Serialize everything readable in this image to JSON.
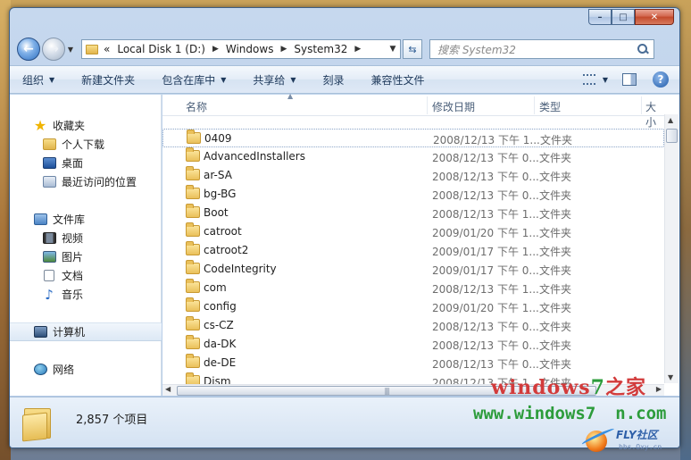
{
  "nav": {
    "breadcrumb_chevrons": "«",
    "crumbs": [
      "Local Disk 1 (D:)",
      "Windows",
      "System32"
    ],
    "search_placeholder": "搜索 System32"
  },
  "commands": [
    "组织",
    "新建文件夹",
    "包含在库中",
    "共享给",
    "刻录",
    "兼容性文件"
  ],
  "command_dropdowns": [
    true,
    false,
    true,
    true,
    false,
    false
  ],
  "sidebar": {
    "favorites": {
      "label": "收藏夹",
      "items": [
        "个人下载",
        "桌面",
        "最近访问的位置"
      ]
    },
    "libraries": {
      "label": "文件库",
      "items": [
        "视频",
        "图片",
        "文档",
        "音乐"
      ]
    },
    "computer": "计算机",
    "network": "网络"
  },
  "columns": {
    "name": "名称",
    "date": "修改日期",
    "type": "类型",
    "size": "大小"
  },
  "files": [
    {
      "name": "0409",
      "date": "2008/12/13 下午 1...",
      "type": "文件夹"
    },
    {
      "name": "AdvancedInstallers",
      "date": "2008/12/13 下午 0...",
      "type": "文件夹"
    },
    {
      "name": "ar-SA",
      "date": "2008/12/13 下午 0...",
      "type": "文件夹"
    },
    {
      "name": "bg-BG",
      "date": "2008/12/13 下午 0...",
      "type": "文件夹"
    },
    {
      "name": "Boot",
      "date": "2008/12/13 下午 1...",
      "type": "文件夹"
    },
    {
      "name": "catroot",
      "date": "2009/01/20 下午 1...",
      "type": "文件夹"
    },
    {
      "name": "catroot2",
      "date": "2009/01/17 下午 1...",
      "type": "文件夹"
    },
    {
      "name": "CodeIntegrity",
      "date": "2009/01/17 下午 0...",
      "type": "文件夹"
    },
    {
      "name": "com",
      "date": "2008/12/13 下午 1...",
      "type": "文件夹"
    },
    {
      "name": "config",
      "date": "2009/01/20 下午 1...",
      "type": "文件夹"
    },
    {
      "name": "cs-CZ",
      "date": "2008/12/13 下午 0...",
      "type": "文件夹"
    },
    {
      "name": "da-DK",
      "date": "2008/12/13 下午 0...",
      "type": "文件夹"
    },
    {
      "name": "de-DE",
      "date": "2008/12/13 下午 0...",
      "type": "文件夹"
    },
    {
      "name": "Dism",
      "date": "2008/12/13 下午 1...",
      "type": "文件夹"
    }
  ],
  "status": {
    "item_count": "2,857 个项目"
  },
  "watermark": {
    "line1_red": "windows",
    "line1_green": "7",
    "line1_suffix": "之家",
    "line2": "www.windows7",
    "line2_suffix": "n.com",
    "logo_text": "FLY社区",
    "logo_sub": "bbs.Oxy.cn"
  },
  "icons": {
    "back": "back-arrow-icon",
    "forward": "forward-arrow-icon",
    "refresh": "refresh-icon",
    "search": "search-icon",
    "help": "help-icon"
  },
  "colors": {
    "accent": "#2e6fc0",
    "folder": "#eac05a",
    "watermark_red": "#d23b3b",
    "watermark_green": "#2c9c3b"
  }
}
